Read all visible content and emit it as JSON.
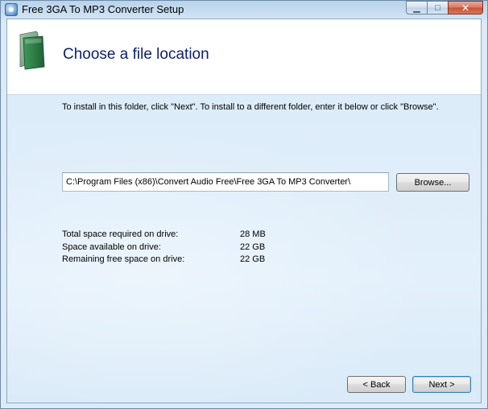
{
  "window": {
    "title": "Free 3GA To MP3 Converter Setup",
    "controls": {
      "minimize": "▁",
      "maximize": "□",
      "close": "✕"
    }
  },
  "header": {
    "title": "Choose a file location",
    "icon": "folder-icon"
  },
  "content": {
    "instruction": "To install in this folder, click \"Next\". To install to a different folder, enter it below or click \"Browse\".",
    "install_path": "C:\\Program Files (x86)\\Convert Audio Free\\Free 3GA To MP3 Converter\\",
    "browse_label": "Browse...",
    "space": [
      {
        "label": "Total space required on drive:",
        "value": "28 MB"
      },
      {
        "label": "Space available on drive:",
        "value": "22 GB"
      },
      {
        "label": "Remaining free space on drive:",
        "value": "22 GB"
      }
    ]
  },
  "footer": {
    "back_label": "< Back",
    "next_label": "Next >"
  },
  "colors": {
    "title_text": "#0b1f6e",
    "header_bg": "#ffffff",
    "body_bg": "#dfeefa",
    "default_button_border": "#3c7fb1"
  }
}
